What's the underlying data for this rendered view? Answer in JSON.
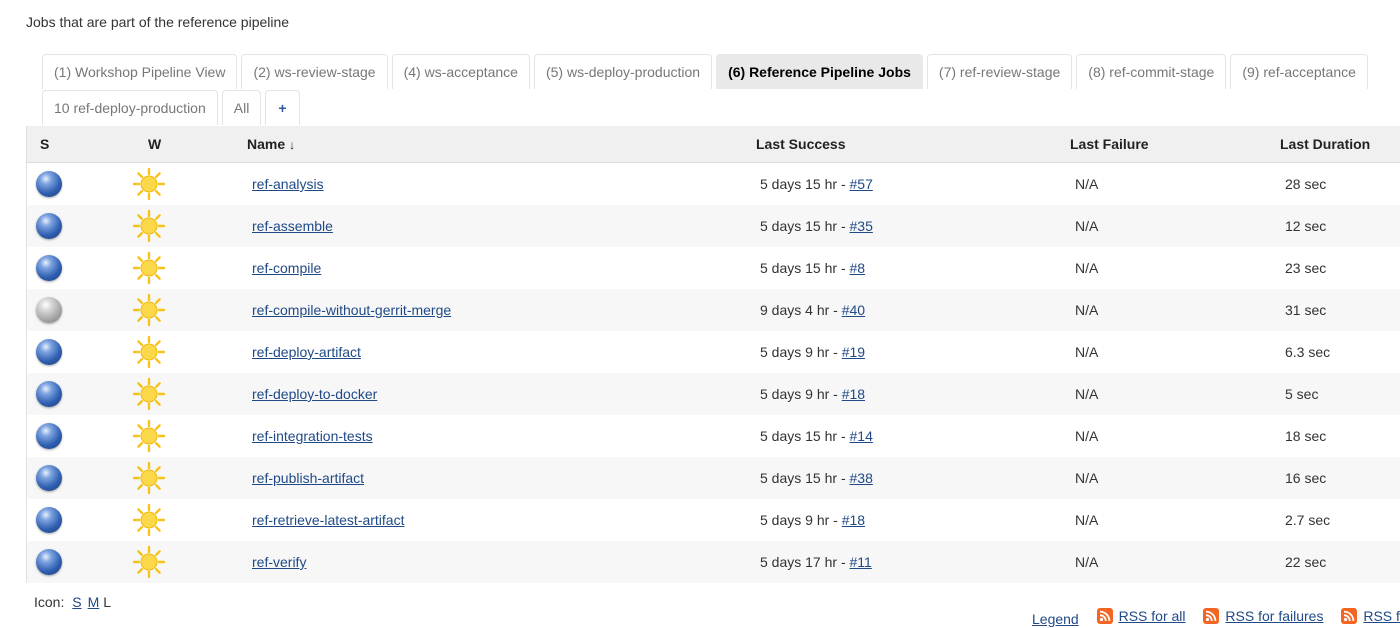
{
  "description": "Jobs that are part of the reference pipeline",
  "tabs_row1": [
    {
      "label": "(1) Workshop Pipeline View",
      "active": false
    },
    {
      "label": "(2) ws-review-stage",
      "active": false
    },
    {
      "label": "(4) ws-acceptance",
      "active": false
    },
    {
      "label": "(5) ws-deploy-production",
      "active": false
    },
    {
      "label": "(6) Reference Pipeline Jobs",
      "active": true
    },
    {
      "label": "(7) ref-review-stage",
      "active": false
    },
    {
      "label": "(8) ref-commit-stage",
      "active": false
    },
    {
      "label": "(9) ref-acceptance",
      "active": false
    }
  ],
  "tabs_row2": [
    {
      "label": "10 ref-deploy-production",
      "active": false
    },
    {
      "label": "All",
      "active": false
    },
    {
      "label": "+",
      "active": false
    }
  ],
  "table": {
    "headers": {
      "s": "S",
      "w": "W",
      "name": "Name",
      "name_sort": "↓",
      "last_success": "Last Success",
      "last_failure": "Last Failure",
      "last_duration": "Last Duration"
    },
    "rows": [
      {
        "status": "blue",
        "weather": "sunny-icon",
        "name": "ref-analysis",
        "success_time": "5 days 15 hr - ",
        "success_build": "#57",
        "failure": "N/A",
        "duration": "28 sec"
      },
      {
        "status": "blue",
        "weather": "sunny-icon",
        "name": "ref-assemble",
        "success_time": "5 days 15 hr - ",
        "success_build": "#35",
        "failure": "N/A",
        "duration": "12 sec"
      },
      {
        "status": "blue",
        "weather": "sunny-icon",
        "name": "ref-compile",
        "success_time": "5 days 15 hr - ",
        "success_build": "#8",
        "failure": "N/A",
        "duration": "23 sec"
      },
      {
        "status": "grey",
        "weather": "sunny-icon",
        "name": "ref-compile-without-gerrit-merge",
        "success_time": "9 days 4 hr - ",
        "success_build": "#40",
        "failure": "N/A",
        "duration": "31 sec"
      },
      {
        "status": "blue",
        "weather": "sunny-icon",
        "name": "ref-deploy-artifact",
        "success_time": "5 days 9 hr - ",
        "success_build": "#19",
        "failure": "N/A",
        "duration": "6.3 sec"
      },
      {
        "status": "blue",
        "weather": "sunny-icon",
        "name": "ref-deploy-to-docker",
        "success_time": "5 days 9 hr - ",
        "success_build": "#18",
        "failure": "N/A",
        "duration": "5 sec"
      },
      {
        "status": "blue",
        "weather": "sunny-icon",
        "name": "ref-integration-tests",
        "success_time": "5 days 15 hr - ",
        "success_build": "#14",
        "failure": "N/A",
        "duration": "18 sec"
      },
      {
        "status": "blue",
        "weather": "sunny-icon",
        "name": "ref-publish-artifact",
        "success_time": "5 days 15 hr - ",
        "success_build": "#38",
        "failure": "N/A",
        "duration": "16 sec"
      },
      {
        "status": "blue",
        "weather": "sunny-icon",
        "name": "ref-retrieve-latest-artifact",
        "success_time": "5 days 9 hr - ",
        "success_build": "#18",
        "failure": "N/A",
        "duration": "2.7 sec"
      },
      {
        "status": "blue",
        "weather": "sunny-icon",
        "name": "ref-verify",
        "success_time": "5 days 17 hr - ",
        "success_build": "#11",
        "failure": "N/A",
        "duration": "22 sec"
      }
    ]
  },
  "footer": {
    "icon_label": "Icon:",
    "icon_sizes": [
      "S",
      "M",
      "L"
    ],
    "legend": "Legend",
    "rss_all": "RSS for all",
    "rss_failures": "RSS for failures",
    "rss_latest": "RSS for just latest builds"
  },
  "colors": {
    "link": "#204a87",
    "active_tab_bg": "#e9e9e9",
    "row_alt_bg": "#f7f7f7",
    "rss_orange": "#f26522"
  }
}
